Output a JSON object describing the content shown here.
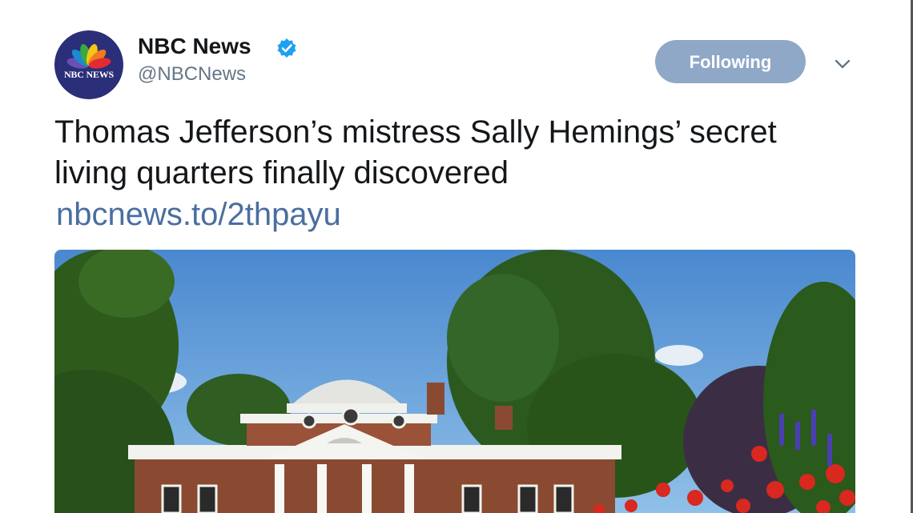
{
  "tweet": {
    "author_name": "NBC News",
    "handle": "@NBCNews",
    "avatar_label": "NBC NEWS",
    "follow_label": "Following",
    "text": "Thomas Jefferson’s mistress Sally Hemings’ secret living quarters finally discovered",
    "link": "nbcnews.to/2thpayu"
  },
  "icons": {
    "verified": "verified-badge-icon",
    "caret": "chevron-down-icon",
    "logo": "nbc-peacock-logo"
  },
  "colors": {
    "follow_button": "#8fa8c8",
    "link": "#4a6ea0",
    "handle": "#657786",
    "verified": "#1da1f2",
    "avatar_bg": "#2b2e78"
  }
}
